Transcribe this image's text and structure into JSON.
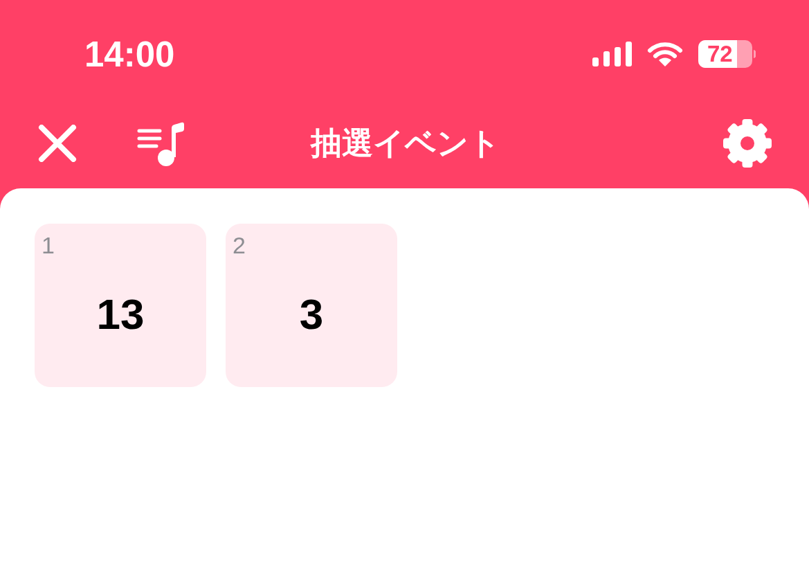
{
  "status_bar": {
    "time": "14:00",
    "battery": "72"
  },
  "nav_bar": {
    "title": "抽選イベント"
  },
  "results": [
    {
      "index": "1",
      "value": "13"
    },
    {
      "index": "2",
      "value": "3"
    }
  ]
}
